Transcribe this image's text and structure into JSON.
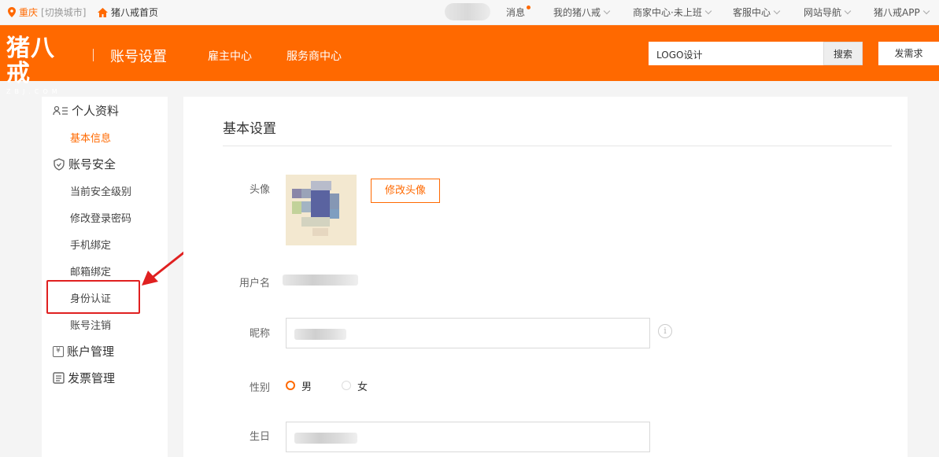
{
  "topbar": {
    "city": "重庆",
    "switch_city": "[切换城市]",
    "home_link": "猪八戒首页",
    "nav": {
      "messages": "消息",
      "my_zbj": "我的猪八戒",
      "merchant_center": "商家中心·未上班",
      "service_center": "客服中心",
      "site_nav": "网站导航",
      "app": "猪八戒APP"
    }
  },
  "header": {
    "logo_cn": "猪八戒",
    "logo_en": "ZBJ.COM",
    "page_title": "账号设置",
    "employer_center": "雇主中心",
    "provider_center": "服务商中心",
    "search_value": "LOGO设计",
    "search_button": "搜索",
    "post_button": "发需求"
  },
  "sidebar": {
    "personal_info": "个人资料",
    "basic_info": "基本信息",
    "account_security": "账号安全",
    "security_level": "当前安全级别",
    "change_password": "修改登录密码",
    "phone_binding": "手机绑定",
    "email_binding": "邮箱绑定",
    "identity_verification": "身份认证",
    "account_cancel": "账号注销",
    "account_management": "账户管理",
    "invoice_management": "发票管理"
  },
  "main": {
    "heading": "基本设置",
    "avatar_label": "头像",
    "change_avatar": "修改头像",
    "username_label": "用户名",
    "nickname_label": "昵称",
    "gender_label": "性别",
    "gender_male": "男",
    "gender_female": "女",
    "birthday_label": "生日"
  },
  "colors": {
    "brand": "#ff6900",
    "annotation": "#e02020"
  }
}
